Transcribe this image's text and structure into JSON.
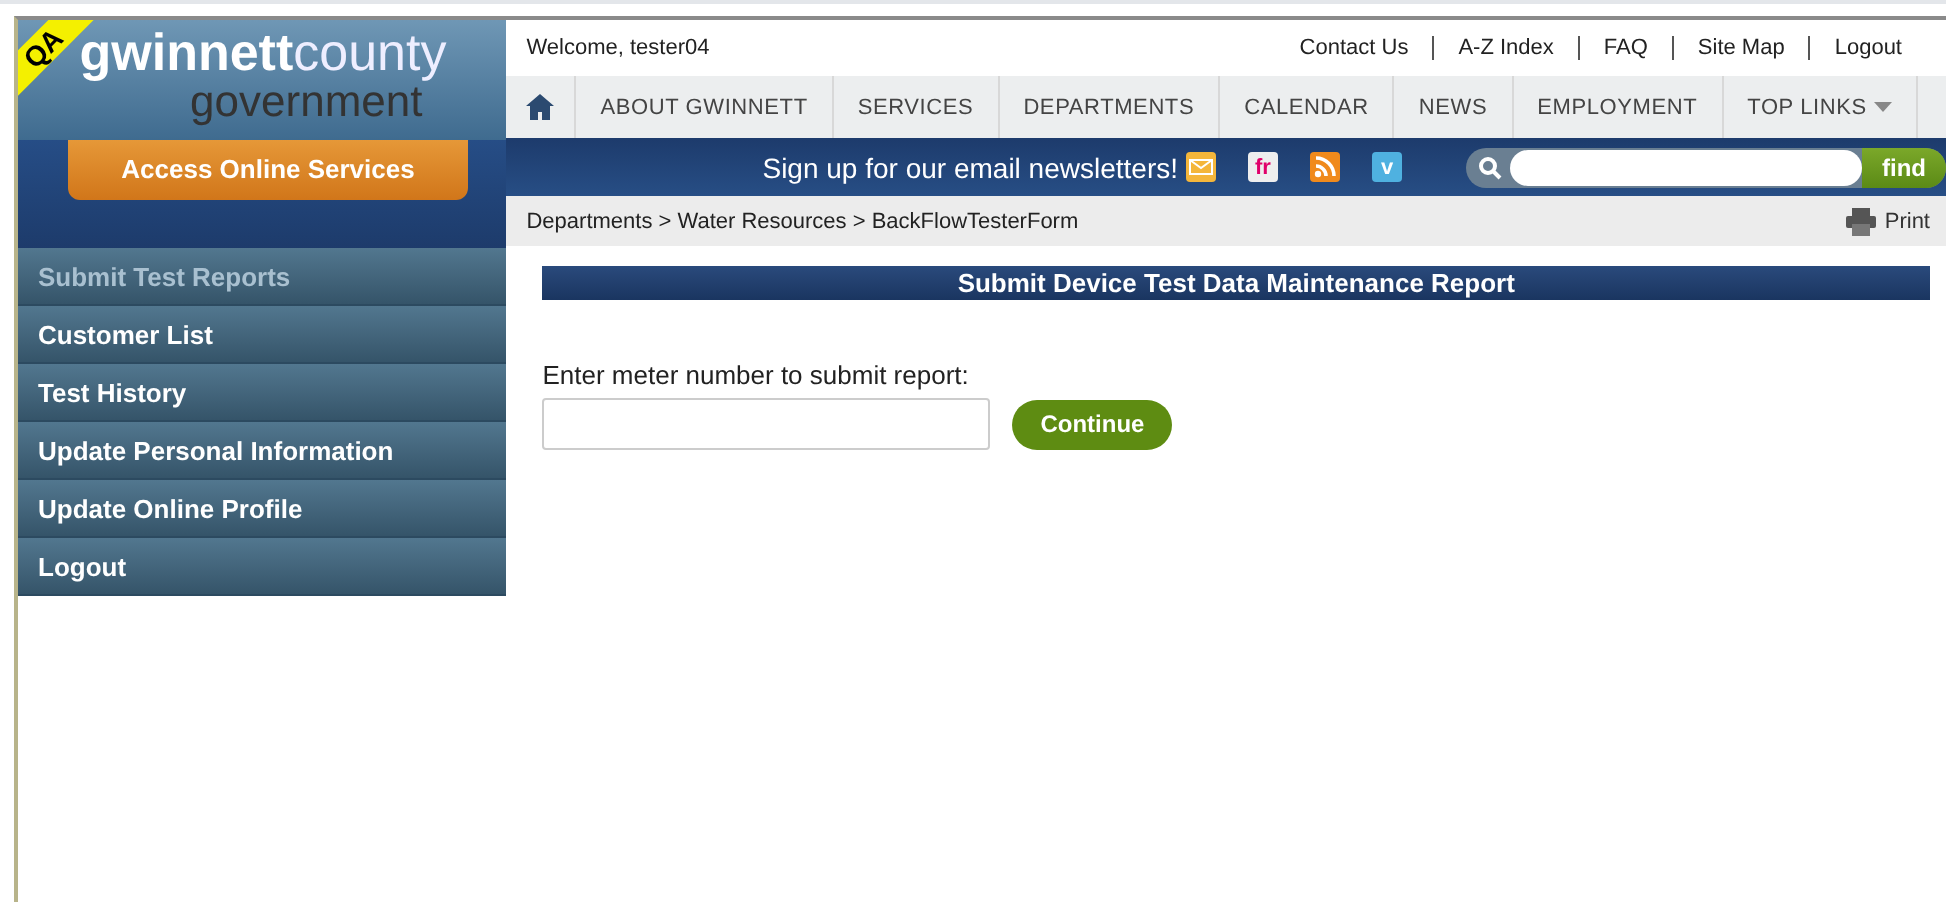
{
  "logo": {
    "badge": "QA",
    "name_bold": "gwinnett",
    "name_light": "county",
    "subtitle": "government"
  },
  "access_button": "Access Online Services",
  "welcome": "Welcome, tester04",
  "utility_links": [
    "Contact Us",
    "A-Z Index",
    "FAQ",
    "Site Map",
    "Logout"
  ],
  "nav": {
    "items": [
      {
        "label": "ABOUT GWINNETT",
        "dropdown": false
      },
      {
        "label": "SERVICES",
        "dropdown": false
      },
      {
        "label": "DEPARTMENTS",
        "dropdown": false
      },
      {
        "label": "CALENDAR",
        "dropdown": false
      },
      {
        "label": "NEWS",
        "dropdown": false
      },
      {
        "label": "EMPLOYMENT",
        "dropdown": false
      },
      {
        "label": "TOP LINKS",
        "dropdown": true
      }
    ]
  },
  "newsletter": "Sign up for our email newsletters!",
  "social": [
    {
      "kind": "flickr",
      "label": "fr"
    },
    {
      "kind": "rss"
    },
    {
      "kind": "vimeo",
      "label": "v"
    }
  ],
  "search": {
    "button": "find"
  },
  "breadcrumb": "Departments > Water Resources > BackFlowTesterForm",
  "print": "Print",
  "sidebar": {
    "items": [
      {
        "label": "Submit Test Reports",
        "selected": true
      },
      {
        "label": "Customer List",
        "selected": false
      },
      {
        "label": "Test History",
        "selected": false
      },
      {
        "label": "Update Personal Information",
        "selected": false
      },
      {
        "label": "Update Online Profile",
        "selected": false
      },
      {
        "label": "Logout",
        "selected": false
      }
    ]
  },
  "form": {
    "title": "Submit Device Test Data Maintenance Report",
    "label": "Enter meter number to submit report:",
    "button": "Continue"
  }
}
